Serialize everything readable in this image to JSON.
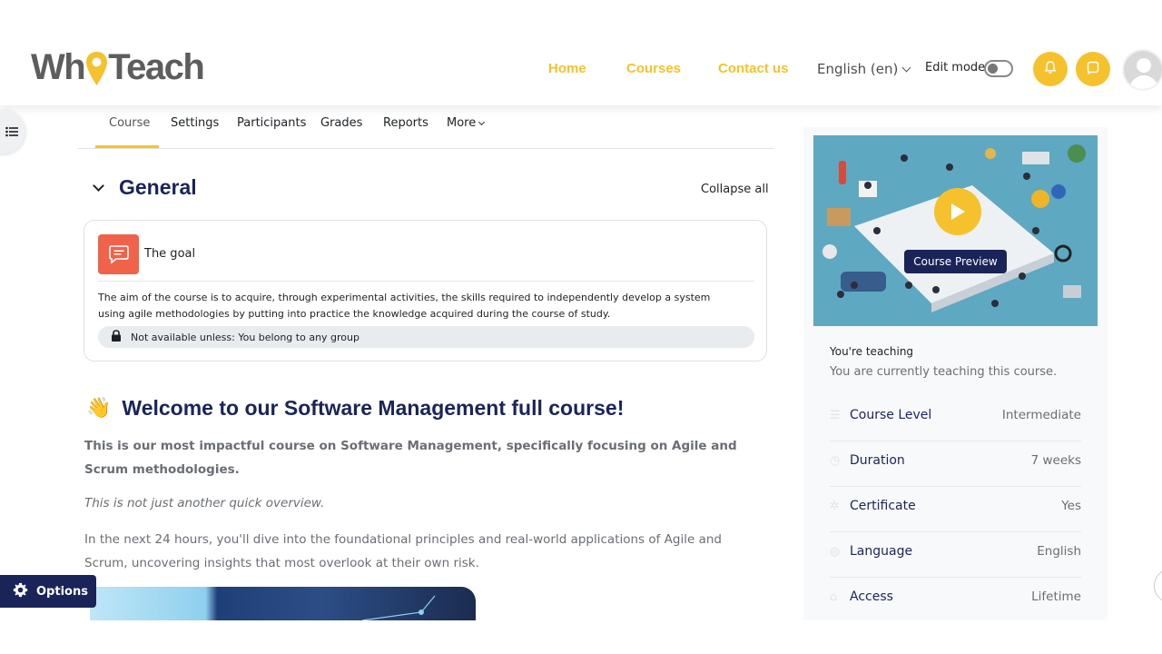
{
  "header": {
    "logo_left": "Wh",
    "logo_right": "Teach",
    "nav": [
      "Home",
      "Courses",
      "Contact us"
    ],
    "language": "English (en)",
    "edit_mode_label": "Edit mode",
    "brand_color": "#f5c22d"
  },
  "secondary_nav": {
    "tabs": [
      "Course",
      "Settings",
      "Participants",
      "Grades",
      "Reports",
      "More"
    ],
    "active_tab": "Course"
  },
  "section": {
    "title": "General",
    "collapse_all": "Collapse all"
  },
  "activity": {
    "icon": "forum-icon",
    "name": "The goal",
    "description": "The aim of the course is to acquire, through experimental activities, the skills required to independently develop a system using agile methodologies by putting into practice the knowledge acquired during the course of study.",
    "restriction": "Not available unless: You belong to any group"
  },
  "welcome": {
    "emoji": "👋",
    "title": "Welcome to our Software Management full course!",
    "bold_intro": "This is our most impactful course on Software Management, specifically focusing on Agile and Scrum methodologies.",
    "italic_line": "This is not just another quick overview.",
    "paragraph": "In the next 24 hours, you'll dive into the foundational principles and real-world applications of Agile and Scrum, uncovering insights that most overlook at their own risk."
  },
  "options_button": "Options",
  "sidebar": {
    "preview_label": "Course Preview",
    "teaching_title": "You're teaching",
    "teaching_subtitle": "You are currently teaching this course.",
    "info": [
      {
        "icon": "level-icon",
        "label": "Course Level",
        "value": "Intermediate"
      },
      {
        "icon": "clock-icon",
        "label": "Duration",
        "value": "7 weeks"
      },
      {
        "icon": "certificate-icon",
        "label": "Certificate",
        "value": "Yes"
      },
      {
        "icon": "globe-icon",
        "label": "Language",
        "value": "English"
      },
      {
        "icon": "lock-icon",
        "label": "Access",
        "value": "Lifetime"
      }
    ]
  }
}
